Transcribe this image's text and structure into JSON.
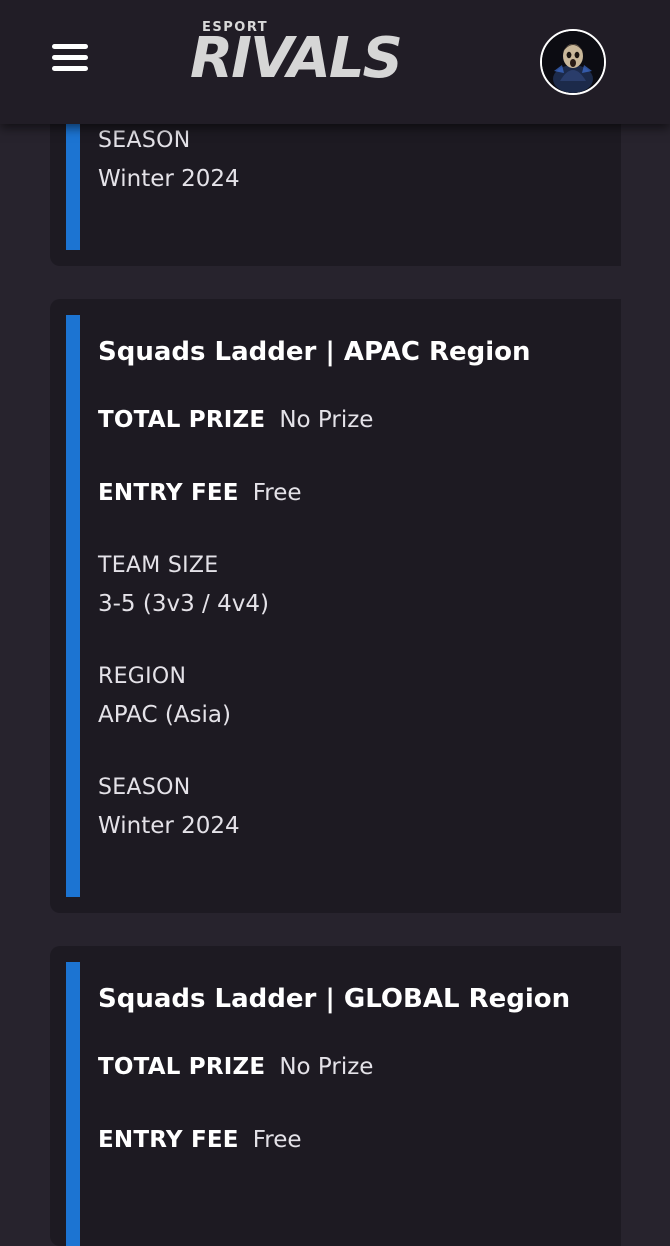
{
  "header": {
    "logo_small": "ESPORT",
    "logo_big": "RIVALS"
  },
  "cards": [
    {
      "season_label": "SEASON",
      "season_value": "Winter 2024"
    },
    {
      "title": "Squads Ladder | APAC Region",
      "total_prize_label": "TOTAL PRIZE",
      "total_prize_value": "No Prize",
      "entry_fee_label": "ENTRY FEE",
      "entry_fee_value": "Free",
      "team_size_label": "TEAM SIZE",
      "team_size_value": "3-5 (3v3 / 4v4)",
      "region_label": "REGION",
      "region_value": "APAC (Asia)",
      "season_label": "SEASON",
      "season_value": "Winter 2024"
    },
    {
      "title": "Squads Ladder | GLOBAL Region",
      "total_prize_label": "TOTAL PRIZE",
      "total_prize_value": "No Prize",
      "entry_fee_label": "ENTRY FEE",
      "entry_fee_value": "Free"
    }
  ],
  "colors": {
    "background": "#27232d",
    "card": "#1d1a22",
    "header": "#211d26",
    "accent": "#1c74d2"
  }
}
